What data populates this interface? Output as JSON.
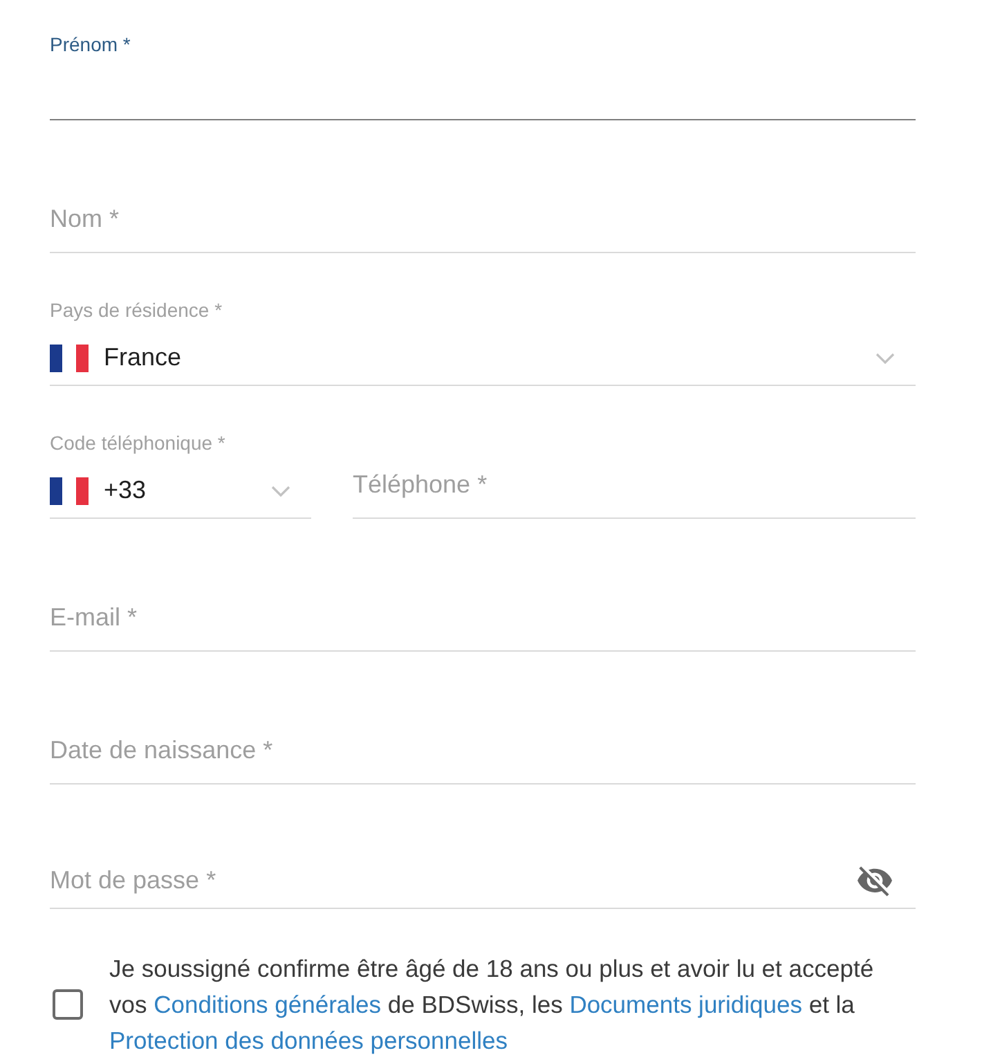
{
  "fields": [
    {
      "kind": "text",
      "label": "Prénom *",
      "focused": true
    },
    {
      "kind": "text",
      "placeholder": "Nom *",
      "focused": false
    },
    {
      "kind": "select",
      "label": "Pays de résidence *",
      "value": "France",
      "focused": false
    },
    {
      "kind": "row",
      "fields": [
        {
          "kind": "select",
          "label": "Code téléphonique *",
          "value": "+33",
          "focused": false
        },
        {
          "kind": "text",
          "placeholder": "Téléphone *",
          "focused": false
        }
      ]
    },
    {
      "kind": "text",
      "placeholder": "E-mail *",
      "focused": false
    },
    {
      "kind": "text",
      "placeholder": "Date de naissance *",
      "focused": false
    },
    {
      "kind": "password",
      "placeholder": "Mot de passe *",
      "focused": false,
      "visible": false
    }
  ],
  "consent": {
    "checked": false,
    "parts": [
      {
        "kind": "text",
        "text": "Je soussigné confirme être âgé de 18 ans ou plus et avoir lu et accepté vos "
      },
      {
        "kind": "link",
        "text": "Conditions générales"
      },
      {
        "kind": "text",
        "text": " de BDSwiss, les "
      },
      {
        "kind": "link",
        "text": "Documents juridiques"
      },
      {
        "kind": "text",
        "text": " et la "
      },
      {
        "kind": "link",
        "text": "Protection des données personnelles"
      }
    ]
  }
}
